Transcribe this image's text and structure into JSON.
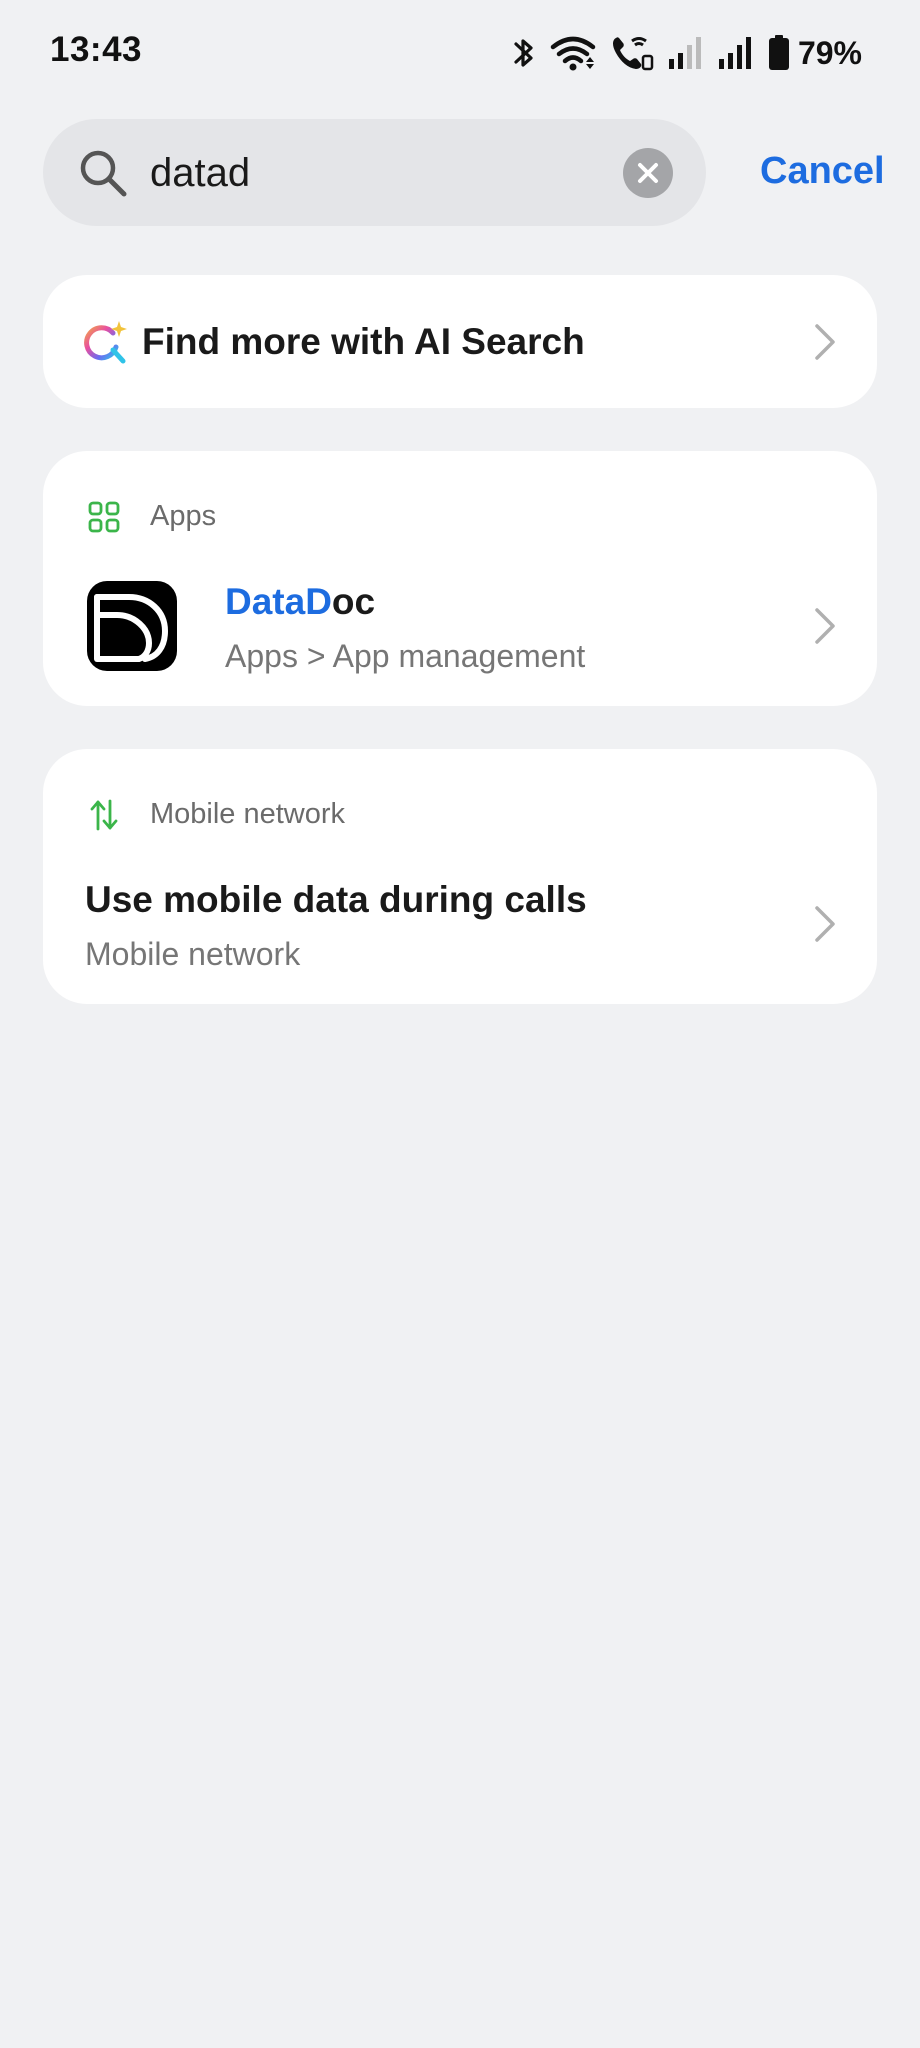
{
  "status_bar": {
    "time": "13:43",
    "battery_percent": "79%",
    "icons": [
      "bluetooth-icon",
      "wifi-icon",
      "wifi-calling-icon",
      "signal-weak-icon",
      "signal-strong-icon",
      "battery-icon"
    ]
  },
  "search": {
    "value": "datad",
    "cancel_label": "Cancel"
  },
  "ai_search": {
    "label": "Find more with AI Search"
  },
  "sections": {
    "apps": {
      "header": "Apps",
      "result": {
        "title_highlight": "DataD",
        "title_rest": "oc",
        "subtitle": "Apps > App management"
      }
    },
    "mobile_network": {
      "header": "Mobile network",
      "result": {
        "title": "Use mobile data during calls",
        "subtitle": "Mobile network"
      }
    }
  },
  "colors": {
    "accent": "#1d6ce0",
    "section_icon": "#3bb54a",
    "background": "#f0f1f3"
  }
}
